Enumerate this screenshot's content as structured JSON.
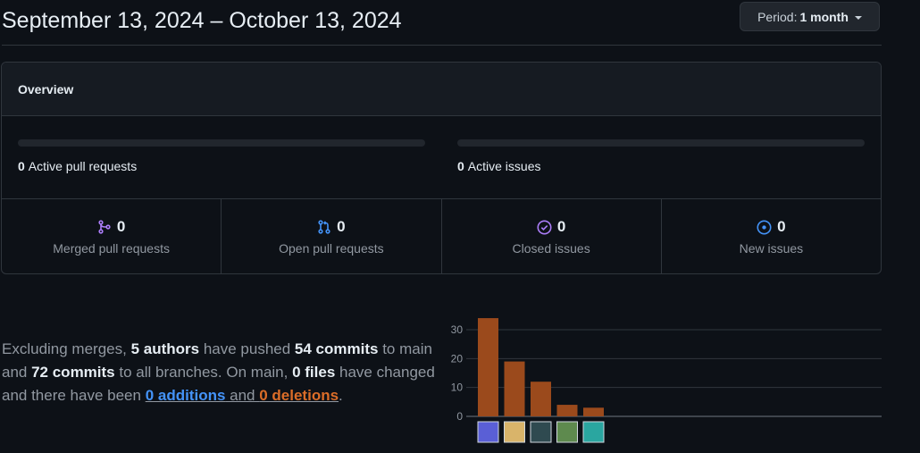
{
  "header": {
    "date_range": "September 13, 2024 – October 13, 2024",
    "period_label": "Period:",
    "period_value": "1 month"
  },
  "overview": {
    "title": "Overview",
    "active_prs_count": "0",
    "active_prs_label": "Active pull requests",
    "active_issues_count": "0",
    "active_issues_label": "Active issues",
    "stats": [
      {
        "count": "0",
        "label": "Merged pull requests",
        "icon": "git-merge-icon",
        "color": "#ab7df8"
      },
      {
        "count": "0",
        "label": "Open pull requests",
        "icon": "git-pull-request-icon",
        "color": "#4493f8"
      },
      {
        "count": "0",
        "label": "Closed issues",
        "icon": "issue-closed-icon",
        "color": "#ab7df8"
      },
      {
        "count": "0",
        "label": "New issues",
        "icon": "issue-opened-icon",
        "color": "#4493f8"
      }
    ]
  },
  "summary": {
    "t1": "Excluding merges, ",
    "authors": "5 authors",
    "t2": " have pushed ",
    "commits_main": "54 commits",
    "t3": " to main and ",
    "commits_all": "72 commits",
    "t4": " to all branches. On main, ",
    "files": "0 files",
    "t5": " have changed and there have been ",
    "additions": "0 additions",
    "t6": " and ",
    "deletions": "0 deletions",
    "t7": "."
  },
  "chart_data": {
    "type": "bar",
    "categories": [
      "author-1",
      "author-2",
      "author-3",
      "author-4",
      "author-5"
    ],
    "values": [
      34,
      19,
      12,
      4,
      3
    ],
    "yticks": [
      0,
      10,
      20,
      30
    ],
    "ylim": [
      0,
      35
    ],
    "color": "#9b4a1c",
    "grid": true
  }
}
